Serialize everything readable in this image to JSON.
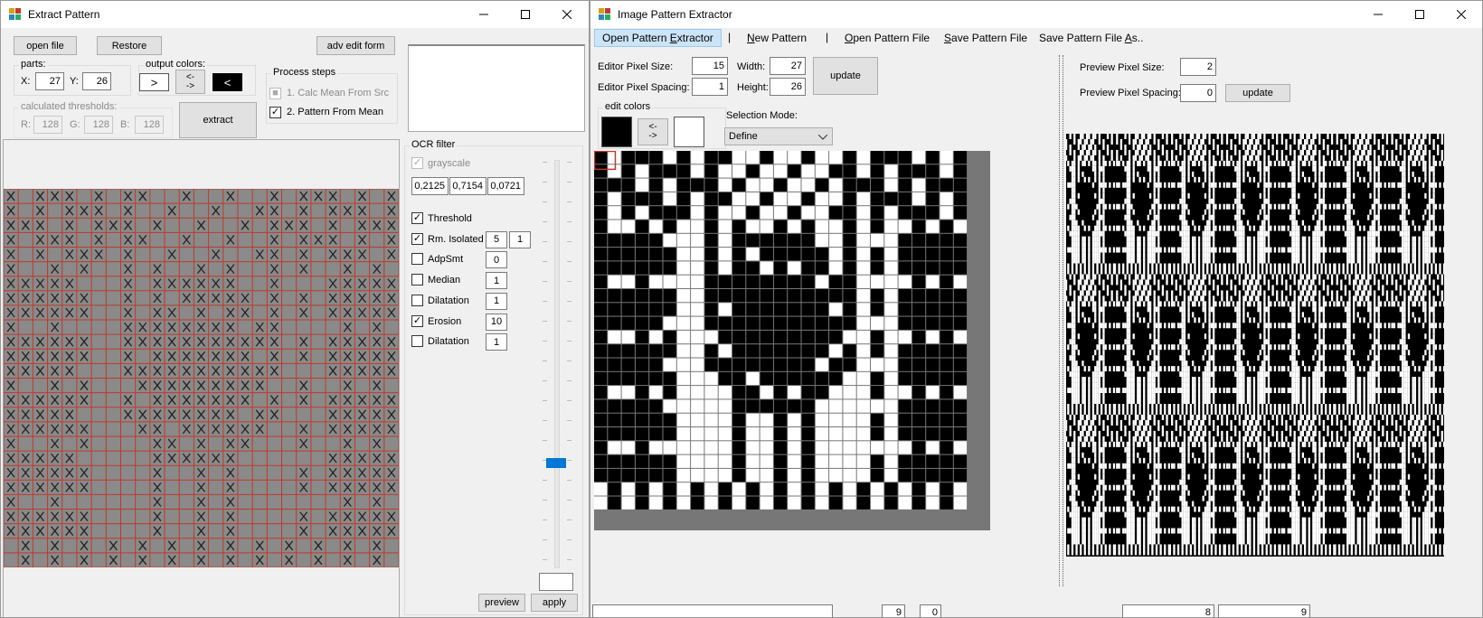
{
  "left_window": {
    "title": "Extract Pattern",
    "buttons": {
      "open_file": "open file",
      "restore": "Restore",
      "adv_edit_form": "adv edit form",
      "extract": "extract",
      "preview": "preview",
      "apply": "apply"
    },
    "parts": {
      "label": "parts:",
      "x_label": "X:",
      "x_value": "27",
      "y_label": "Y:",
      "y_value": "26"
    },
    "output_colors": {
      "label": "output colors:",
      "btn_next": ">",
      "btn_swap_top": "<-",
      "btn_swap_bottom": "->",
      "btn_prev": "<"
    },
    "process_steps": {
      "label": "Process steps",
      "step1": "1. Calc Mean From Src",
      "step1_checked": true,
      "step2": "2. Pattern From Mean",
      "step2_checked": true
    },
    "thresholds": {
      "label": "calculated thresholds:",
      "r_label": "R:",
      "r": "128",
      "g_label": "G:",
      "g": "128",
      "b_label": "B:",
      "b": "128"
    },
    "ocr": {
      "label": "OCR filter",
      "grayscale": "grayscale",
      "weights": [
        "0,2125",
        "0,7154",
        "0,0721"
      ],
      "filters": [
        {
          "name": "Threshold",
          "checked": true,
          "values": []
        },
        {
          "name": "Rm. Isolated",
          "checked": true,
          "values": [
            "5",
            "1"
          ]
        },
        {
          "name": "AdpSmt",
          "checked": false,
          "values": [
            "0"
          ]
        },
        {
          "name": "Median",
          "checked": false,
          "values": [
            "1"
          ]
        },
        {
          "name": "Dilatation",
          "checked": false,
          "values": [
            "1"
          ]
        },
        {
          "name": "Erosion",
          "checked": true,
          "values": [
            "10"
          ]
        },
        {
          "name": "Dilatation",
          "checked": false,
          "values": [
            "1"
          ]
        }
      ]
    }
  },
  "right_window": {
    "title": "Image Pattern Extractor",
    "menu": [
      {
        "label": "Open Pattern Extractor",
        "ul": "E",
        "selected": true
      },
      {
        "label": "New Pattern",
        "ul": "N",
        "selected": false
      },
      {
        "label": "Open Pattern File",
        "ul": "O",
        "selected": false
      },
      {
        "label": "Save Pattern File",
        "ul": "S",
        "selected": false
      },
      {
        "label": "Save Pattern File As..",
        "ul": "A",
        "selected": false
      }
    ],
    "menu_separator": "|",
    "editor": {
      "pixel_size_label": "Editor Pixel Size:",
      "pixel_size": "15",
      "spacing_label": "Editor Pixel Spacing:",
      "spacing": "1",
      "width_label": "Width:",
      "width": "27",
      "height_label": "Height:",
      "height": "26",
      "update": "update"
    },
    "edit_colors": {
      "label": "edit colors",
      "swap_top": "<-",
      "swap_bottom": "->",
      "color_a": "#000000",
      "color_b": "#ffffff"
    },
    "selection_mode": {
      "label": "Selection Mode:",
      "value": "Define"
    },
    "preview": {
      "pixel_size_label": "Preview Pixel Size:",
      "pixel_size": "2",
      "spacing_label": "Preview Pixel Spacing:",
      "spacing": "0",
      "update": "update"
    },
    "status": {
      "field1": "",
      "field2": "9",
      "field3": "0",
      "field4": "8",
      "field5": "9"
    }
  },
  "colors": {
    "grid_line": "#c0392b",
    "slider_thumb": "#0078d7",
    "selection_highlight": "#cce4f7"
  }
}
